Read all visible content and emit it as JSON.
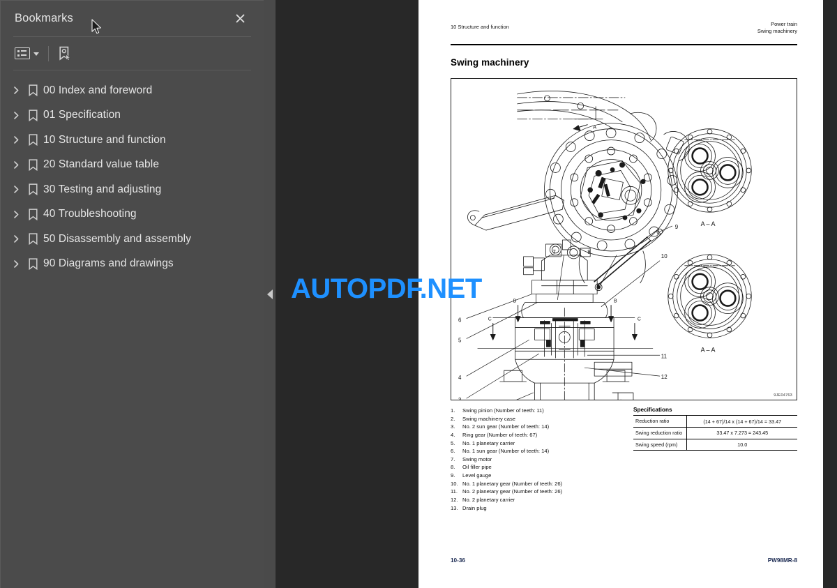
{
  "sidebar": {
    "title": "Bookmarks",
    "close_icon": "close-icon",
    "toolbar": {
      "list_view_icon": "list-view-icon",
      "list_view_caret_icon": "chevron-down-icon",
      "new_bookmark_icon": "new-bookmark-icon"
    },
    "items": [
      {
        "label": "00 Index and foreword"
      },
      {
        "label": "01 Specification"
      },
      {
        "label": "10 Structure and function"
      },
      {
        "label": "20 Standard value table"
      },
      {
        "label": "30 Testing and adjusting"
      },
      {
        "label": "40 Troubleshooting"
      },
      {
        "label": "50 Disassembly and assembly"
      },
      {
        "label": "90 Diagrams and drawings"
      }
    ]
  },
  "gutter": {
    "collapse_icon": "chevron-left-icon"
  },
  "document": {
    "running_head_left": "10 Structure and function",
    "running_head_right_line1": "Power train",
    "running_head_right_line2": "Swing machinery",
    "title": "Swing machinery",
    "figure_code": "9JE04763",
    "figure_section_label_top": "A – A",
    "figure_section_label_bottom": "A – A",
    "figure_view_label_1": "A – A",
    "figure_view_label_2": "A – A",
    "parts": [
      {
        "num": "1.",
        "text": "Swing pinion (Number of teeth: 11)"
      },
      {
        "num": "2.",
        "text": "Swing machinery case"
      },
      {
        "num": "3.",
        "text": "No. 2 sun gear (Number of teeth: 14)"
      },
      {
        "num": "4.",
        "text": "Ring gear (Number of teeth: 67)"
      },
      {
        "num": "5.",
        "text": "No. 1 planetary carrier"
      },
      {
        "num": "6.",
        "text": "No. 1 sun gear (Number of teeth: 14)"
      },
      {
        "num": "7.",
        "text": "Swing motor"
      },
      {
        "num": "8.",
        "text": "Oil filler pipe"
      },
      {
        "num": "9.",
        "text": "Level gauge"
      },
      {
        "num": "10.",
        "text": "No. 1 planetary gear (Number of teeth: 26)"
      },
      {
        "num": "11.",
        "text": "No. 2 planetary gear (Number of teeth: 26)"
      },
      {
        "num": "12.",
        "text": "No. 2 planetary carrier"
      },
      {
        "num": "13.",
        "text": "Drain plug"
      }
    ],
    "specifications": {
      "heading": "Specifications",
      "rows": [
        {
          "key": "Reduction ratio",
          "value": "(14 + 67)/14 x (14 + 67)/14 = 33.47"
        },
        {
          "key": "Swing reduction ratio",
          "value": "33.47 x 7.273 = 243.45"
        },
        {
          "key": "Swing speed (rpm)",
          "value": "10.0"
        }
      ]
    },
    "footer_left": "10-36",
    "footer_right": "PW98MR-8"
  },
  "watermark": {
    "text": "AUTOPDF.NET",
    "color": "#1e90ff"
  },
  "cursor": {
    "icon": "mouse-pointer-icon"
  },
  "theme": {
    "sidebar_bg": "#4b4b4b",
    "viewer_bg": "#282828",
    "gutter_bg": "#4a4a4a",
    "page_bg": "#ffffff",
    "text_light": "#e6e6e6"
  }
}
